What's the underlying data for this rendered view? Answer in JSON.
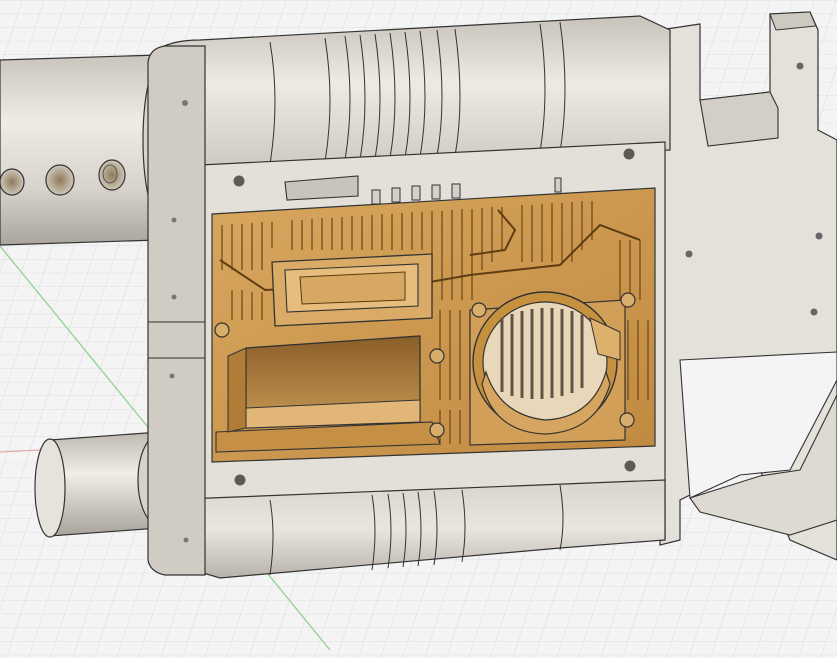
{
  "app": {
    "type": "3D CAD modeling viewport"
  },
  "viewport": {
    "background": "#f4f4f4",
    "grid_minor": "#dadada",
    "grid_major": "#c4c4c4",
    "axis_green": "#7fd07f",
    "axis_red": "#e58a8a",
    "model": {
      "body_color": "#dedad3",
      "body_shade": "#bdb8b0",
      "body_dark": "#8f8a83",
      "insert_color": "#d4a25a",
      "insert_dark": "#9c6a2a",
      "insert_light": "#e7bf7f",
      "edge_color": "#2e2e2e"
    }
  }
}
